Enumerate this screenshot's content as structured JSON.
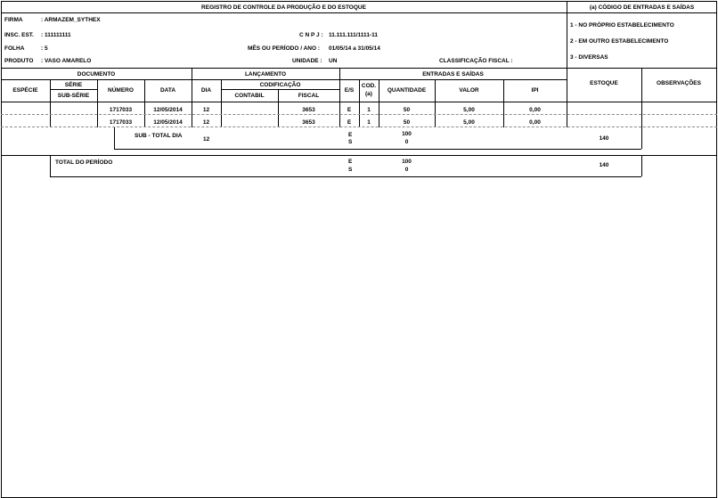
{
  "report_title": "REGISTRO DE CONTROLE DA PRODUÇÃO E DO ESTOQUE",
  "code_box": {
    "title": "(a) CÓDIGO DE ENTRADAS E SAÍDAS",
    "items": [
      "1 - NO PRÓPRIO ESTABELECIMENTO",
      "2 - EM OUTRO ESTABELECIMENTO",
      "3 - DIVERSAS"
    ]
  },
  "header": {
    "firma_label": "FIRMA",
    "firma_value": ": ARMAZEM_SYTHEX",
    "insc_label": "INSC. EST.",
    "insc_value": ": 111111111",
    "cnpj_label": "C N P J :",
    "cnpj_value": "11.111.111/1111-11",
    "folha_label": "FOLHA",
    "folha_value": ": 5",
    "periodo_label": "MÊS OU PERÍODO / ANO :",
    "periodo_value": "01/05/14 a 31/05/14",
    "produto_label": "PRODUTO",
    "produto_value": ": VASO AMARELO",
    "unidade_label": "UNIDADE :",
    "unidade_value": "UN",
    "class_label": "CLASSIFICAÇÃO FISCAL :"
  },
  "columns": {
    "documento": "DOCUMENTO",
    "lancamento": "LANÇAMENTO",
    "entradas_saidas": "ENTRADAS E SAÍDAS",
    "especie": "ESPÉCIE",
    "serie": "SÉRIE",
    "subserie": "SUB-SÉRIE",
    "numero": "NÚMERO",
    "data": "DATA",
    "dia": "DIA",
    "codificacao": "CODIFICAÇÃO",
    "contabil": "CONTABIL",
    "fiscal": "FISCAL",
    "es": "E/S",
    "cod1": "COD.",
    "cod2": "(a)",
    "quantidade": "QUANTIDADE",
    "valor": "VALOR",
    "ipi": "IPI",
    "estoque": "ESTOQUE",
    "observacoes": "OBSERVAÇÕES"
  },
  "rows": [
    {
      "numero": "1717033",
      "data": "12/05/2014",
      "dia": "12",
      "fiscal": "3653",
      "es": "E",
      "cod": "1",
      "quantidade": "50",
      "valor": "5,00",
      "ipi": "0,00"
    },
    {
      "numero": "1717033",
      "data": "12/05/2014",
      "dia": "12",
      "fiscal": "3653",
      "es": "E",
      "cod": "1",
      "quantidade": "50",
      "valor": "5,00",
      "ipi": "0,00"
    }
  ],
  "subtotal": {
    "label": "SUB - TOTAL DIA",
    "dia": "12",
    "e": "E",
    "s": "S",
    "qtd_e": "100",
    "qtd_s": "0",
    "estoque": "140"
  },
  "total": {
    "label": "TOTAL DO PERÍODO",
    "e": "E",
    "s": "S",
    "qtd_e": "100",
    "qtd_s": "0",
    "estoque": "140"
  }
}
